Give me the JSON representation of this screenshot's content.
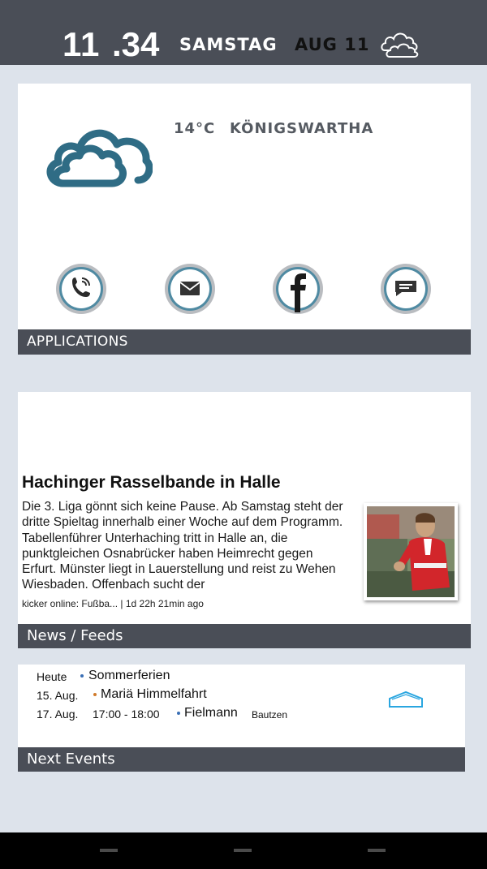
{
  "status_bar": {
    "clock_hours": "11",
    "clock_minutes": ".34",
    "day": "SAMSTAG",
    "date": "AUG 11",
    "weather_icon": "cloud-outline-icon"
  },
  "weather": {
    "temperature": "14°C",
    "location": "KÖNIGSWARTHA",
    "icon": "cloud-icon",
    "icon_color": "#2f6c85"
  },
  "applications": {
    "title": "APPLICATIONS",
    "apps": [
      {
        "name": "phone",
        "icon": "phone-icon"
      },
      {
        "name": "mail",
        "icon": "mail-icon"
      },
      {
        "name": "facebook",
        "icon": "facebook-icon"
      },
      {
        "name": "messages",
        "icon": "message-icon"
      }
    ]
  },
  "news": {
    "section_title": "News / Feeds",
    "headline": "Hachinger Rasselbande in Halle",
    "body_lines": [
      "Die 3. Liga gönnt sich keine Pause. Ab Samstag steht der",
      "dritte Spieltag innerhalb einer Woche auf dem Programm.",
      "Tabellenführer Unterhaching tritt in Halle an, die",
      "punktgleichen Osnabrücker haben Heimrecht gegen",
      "Erfurt. Münster liegt in Lauerstellung und reist zu Wehen",
      "Wiesbaden. Offenbach sucht der"
    ],
    "meta": "kicker online: Fußba... | 1d 22h 21min ago"
  },
  "events": {
    "section_title": "Next Events",
    "items": [
      {
        "date": "Heute",
        "time": "",
        "title": "Sommerferien",
        "location": "",
        "dot_color": "#3a6fb5"
      },
      {
        "date": "15. Aug.",
        "time": "",
        "title": "Mariä Himmelfahrt",
        "location": "",
        "dot_color": "#d07a2a"
      },
      {
        "date": "17. Aug.",
        "time": "17:00 - 18:00",
        "title": "Fielmann",
        "location": "Bautzen",
        "dot_color": "#3a6fb5"
      }
    ],
    "home_icon": "home-outline-icon",
    "home_icon_color": "#2aa6e0"
  },
  "colors": {
    "background": "#dde3eb",
    "bar": "#4a4e57",
    "accent": "#4f8aa2"
  }
}
